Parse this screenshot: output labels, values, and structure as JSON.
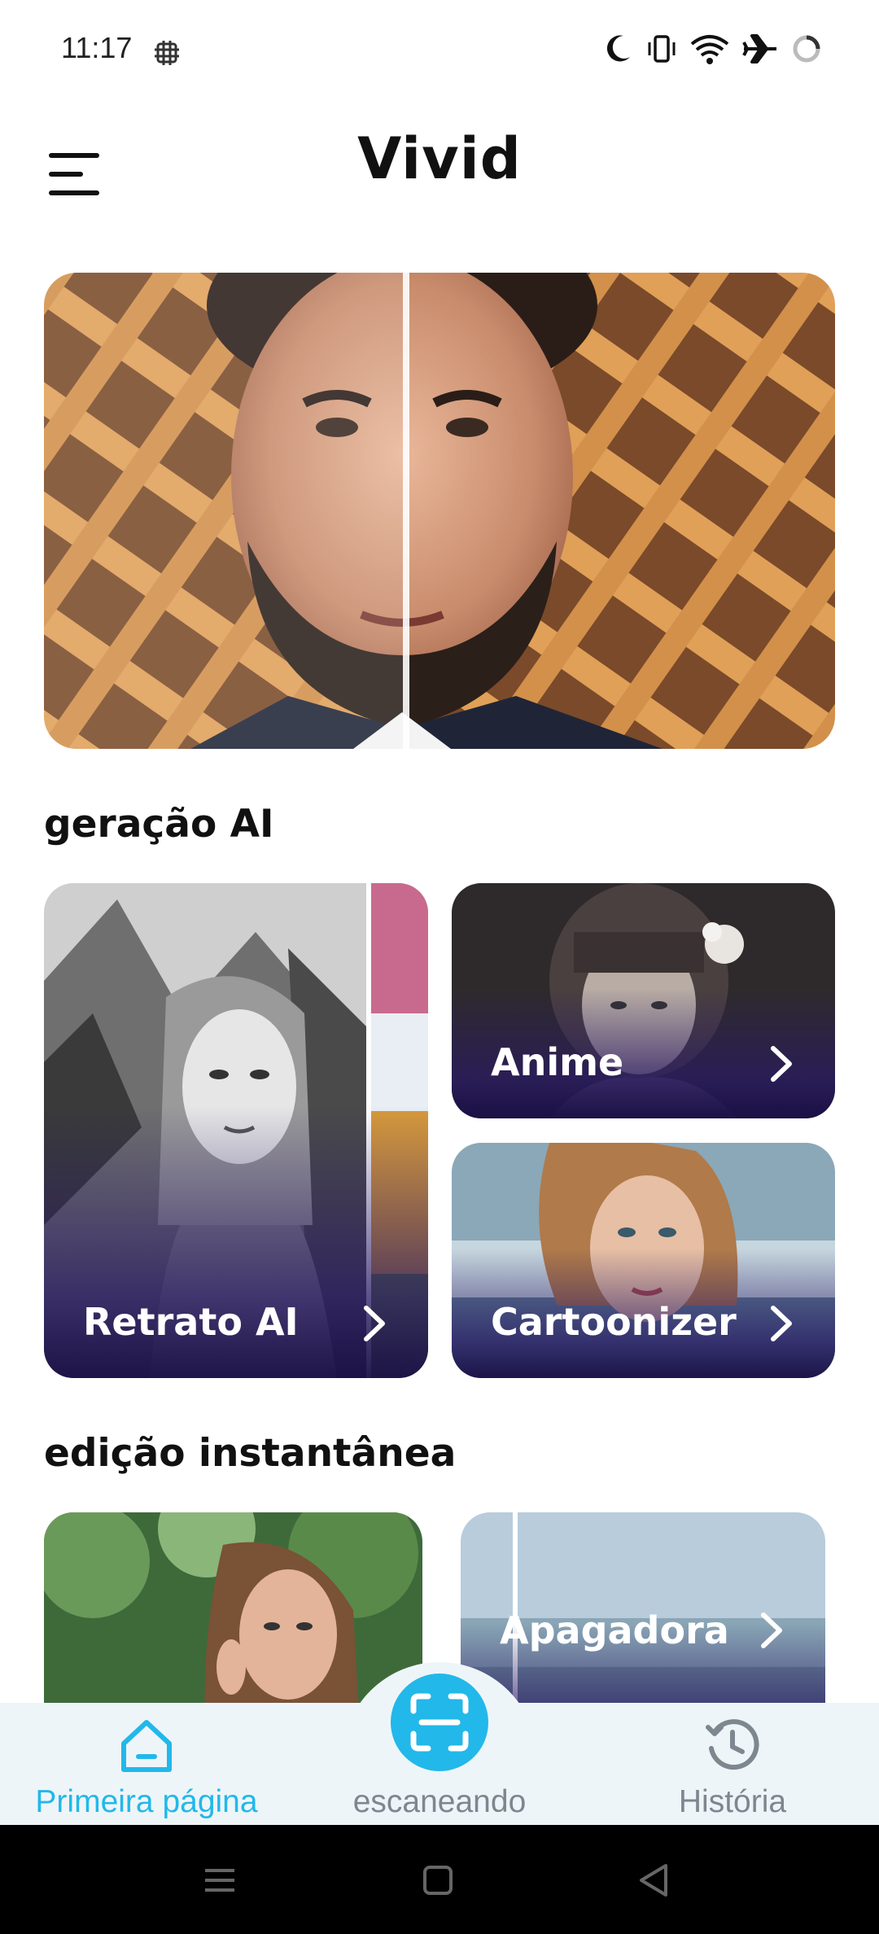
{
  "status_bar": {
    "time": "11:17"
  },
  "header": {
    "title": "Vivid"
  },
  "sections": {
    "ai_generation": {
      "title": "geração AI",
      "cards": [
        {
          "label": "Retrato AI"
        },
        {
          "label": "Anime"
        },
        {
          "label": "Cartoonizer"
        }
      ]
    },
    "instant_edit": {
      "title": "edição instantânea",
      "cards": [
        {
          "label": ""
        },
        {
          "label": "Apagadora"
        }
      ]
    }
  },
  "bottom_nav": {
    "items": [
      {
        "label": "Primeira página",
        "active": true
      },
      {
        "label": "escaneando",
        "active": false
      },
      {
        "label": "História",
        "active": false
      }
    ]
  },
  "colors": {
    "accent": "#22b8ea",
    "nav_inactive": "#7d8790",
    "nav_background": "#eef5f8"
  }
}
